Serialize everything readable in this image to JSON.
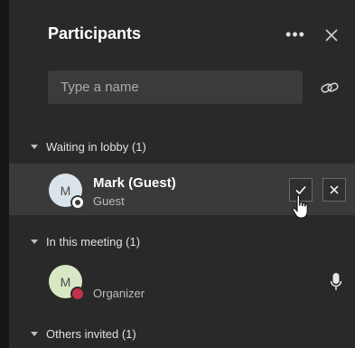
{
  "panel": {
    "title": "Participants",
    "more_label": "•••"
  },
  "search": {
    "placeholder": "Type a name"
  },
  "sections": {
    "lobby": {
      "label": "Waiting in lobby (1)",
      "participant": {
        "initial": "M",
        "name": "Mark (Guest)",
        "role": "Guest",
        "avatar_color": "#d8e4ea",
        "status": "offline"
      }
    },
    "meeting": {
      "label": "In this meeting (1)",
      "participant": {
        "initial": "M",
        "name": "",
        "role": "Organizer",
        "avatar_color": "#d9e8c4",
        "status": "do-not-disturb"
      }
    },
    "invited": {
      "label": "Others invited (1)"
    }
  },
  "colors": {
    "background": "#292929",
    "lobby_row": "#3a3a3a",
    "dnd_red": "#c4314b"
  },
  "icons": [
    "more-icon",
    "close-icon",
    "link-icon",
    "check-icon",
    "dismiss-icon",
    "mic-icon",
    "caret-down-icon",
    "pointer-cursor-icon"
  ]
}
